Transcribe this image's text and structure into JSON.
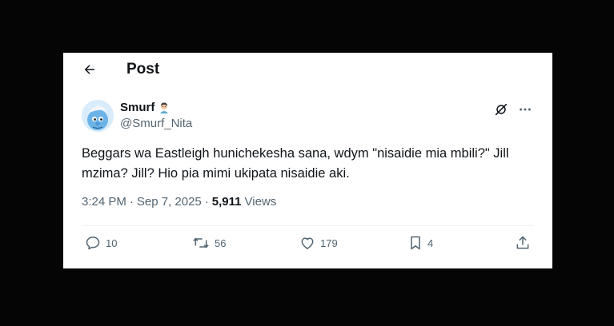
{
  "header": {
    "title": "Post"
  },
  "post": {
    "author": {
      "name": "Smurf",
      "handle": "@Smurf_Nita"
    },
    "text": "Beggars wa Eastleigh hunichekesha sana, wdym \"nisaidie mia mbili?\" Jill mzima? Jill? Hio pia mimi ukipata nisaidie aki.",
    "time": "3:24 PM",
    "separator": "·",
    "date": "Sep 7, 2025",
    "views_count": "5,911",
    "views_label": "Views"
  },
  "actions": {
    "replies": "10",
    "reposts": "56",
    "likes": "179",
    "bookmarks": "4"
  },
  "icons": [
    "back-arrow-icon",
    "grok-icon",
    "more-icon",
    "reply-icon",
    "repost-icon",
    "like-icon",
    "bookmark-icon",
    "share-icon"
  ]
}
